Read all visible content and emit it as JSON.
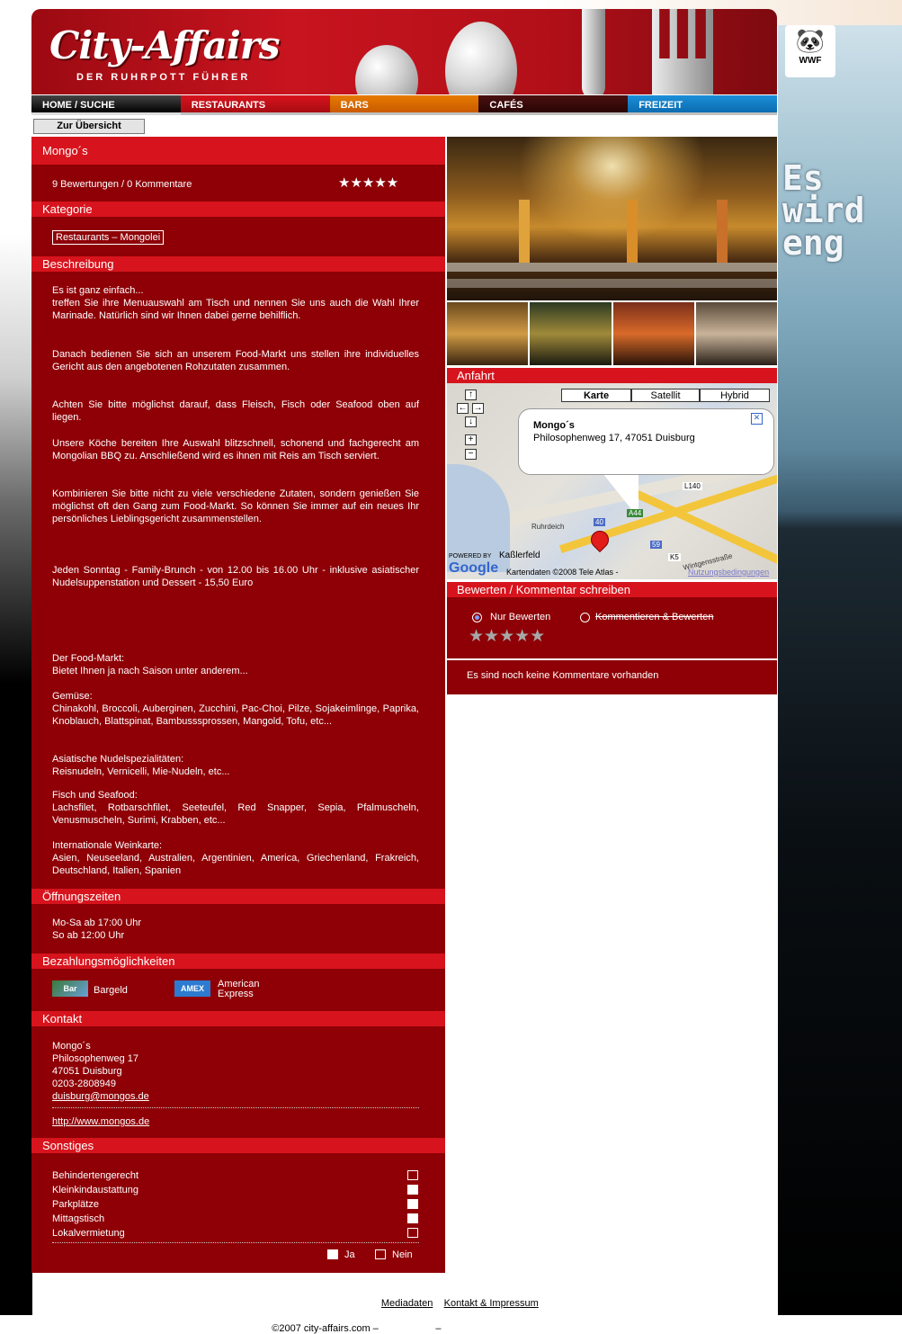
{
  "header": {
    "logo_text": "City-Affairs",
    "tagline": "DER RUHRPOTT FÜHRER"
  },
  "nav": {
    "items": [
      "HOME / SUCHE",
      "RESTAURANTS",
      "BARS",
      "CAFÉS",
      "FREIZEIT"
    ]
  },
  "back_button": "Zur Übersicht",
  "ad": {
    "brand": "WWF",
    "slogan": "Es wird eng"
  },
  "venue": {
    "name": "Mongo´s",
    "ratings_summary": "9 Bewertungen / 0 Kommentare",
    "rating_value": 4.5,
    "rating_stars_text": "★★★★★"
  },
  "sections": {
    "kategorie": "Kategorie",
    "beschreibung": "Beschreibung",
    "oeffnungszeiten": "Öffnungszeiten",
    "bezahlung": "Bezahlungsmöglichkeiten",
    "kontakt": "Kontakt",
    "sonstiges": "Sonstiges",
    "anfahrt": "Anfahrt",
    "bewerten": "Bewerten / Kommentar schreiben"
  },
  "category": "Restaurants – Mongolei",
  "description": {
    "p1": "Es ist ganz einfach...\ntreffen Sie ihre Menuauswahl am Tisch und nennen Sie uns auch die Wahl Ihrer Marinade. Natürlich sind wir Ihnen dabei gerne behilflich.",
    "p2": "Danach bedienen Sie sich an unserem Food-Markt uns stellen ihre individuelles Gericht aus den angebotenen Rohzutaten zusammen.",
    "p3": "Achten Sie bitte möglichst darauf, dass Fleisch, Fisch oder Seafood oben auf liegen.",
    "p4": "Unsere Köche bereiten Ihre Auswahl blitzschnell, schonend und fachgerecht am Mongolian BBQ zu. Anschließend wird es ihnen mit Reis am Tisch serviert.",
    "p5": "Kombinieren Sie bitte nicht zu viele verschiedene Zutaten, sondern genießen Sie möglichst oft den Gang zum Food-Markt. So können Sie immer auf ein neues Ihr persönliches Lieblingsgericht zusammenstellen.",
    "p6": "Jeden Sonntag - Family-Brunch - von 12.00 bis 16.00 Uhr - inklusive asiatischer Nudelsuppenstation und Dessert - 15,50 Euro",
    "p7": "Der Food-Markt:\nBietet Ihnen ja nach Saison unter anderem...",
    "p8": "Gemüse:\nChinakohl, Broccoli, Auberginen, Zucchini, Pac-Choi, Pilze, Sojakeimlinge, Paprika, Knoblauch, Blattspinat, Bambusssprossen, Mangold, Tofu, etc...",
    "p9": "Asiatische Nudelspezialitäten:\nReisnudeln, Vernicelli, Mie-Nudeln, etc...",
    "p10": "Fisch und Seafood:\nLachsfilet, Rotbarschfilet, Seeteufel, Red Snapper, Sepia, Pfalmuscheln, Venusmuscheln, Surimi, Krabben, etc...",
    "p11": "Internationale Weinkarte:\nAsien, Neuseeland, Australien, Argentinien, America, Griechenland, Frakreich, Deutschland, Italien, Spanien"
  },
  "opening_hours": {
    "line1": "Mo-Sa ab 17:00 Uhr",
    "line2": "So ab 12:00 Uhr"
  },
  "payment": {
    "cash_icon_text": "Bar",
    "cash_label": "Bargeld",
    "amex_icon_text": "AMEX",
    "amex_label": "American Express"
  },
  "contact": {
    "name": "Mongo´s",
    "street": "Philosophenweg 17",
    "city": "47051 Duisburg",
    "phone": "0203-2808949",
    "email": "duisburg@mongos.de",
    "website": "http://www.mongos.de"
  },
  "misc": {
    "items": [
      {
        "label": "Behindertengerecht",
        "value": false
      },
      {
        "label": "Kleinkindaustattung",
        "value": true
      },
      {
        "label": "Parkplätze",
        "value": true
      },
      {
        "label": "Mittagstisch",
        "value": true
      },
      {
        "label": "Lokalvermietung",
        "value": false
      }
    ],
    "legend_yes": "Ja",
    "legend_no": "Nein"
  },
  "map": {
    "type_buttons": [
      "Karte",
      "Satellit",
      "Hybrid"
    ],
    "active_type": "Karte",
    "popup_title": "Mongo´s",
    "popup_address": "Philosophenweg 17, 47051 Duisburg",
    "labels": [
      "Ruhrdeich",
      "Kaßlerfeld",
      "Wintgensstraße",
      "L140",
      "40",
      "59",
      "K5",
      "A44"
    ],
    "powered_by": "POWERED BY",
    "google": "Google",
    "copyright": "Kartendaten ©2008 Tele Atlas -",
    "terms": "Nutzungsbedingungen"
  },
  "rating_form": {
    "option_rate": "Nur Bewerten",
    "option_comment": "Kommentieren & Bewerten",
    "selected": "Nur Bewerten",
    "stars": "★★★★★"
  },
  "comments": {
    "empty": "Es sind noch keine Kommentare vorhanden"
  },
  "footer": {
    "copyright": "©2007 city-affairs.com –",
    "sep": "–",
    "mediadaten": "Mediadaten",
    "kontakt": "Kontakt & Impressum"
  },
  "colors": {
    "primary_red": "#8e0006",
    "section_red": "#d7141d",
    "nav_bars": "#e67b00",
    "nav_freizeit": "#1b8fd8"
  }
}
